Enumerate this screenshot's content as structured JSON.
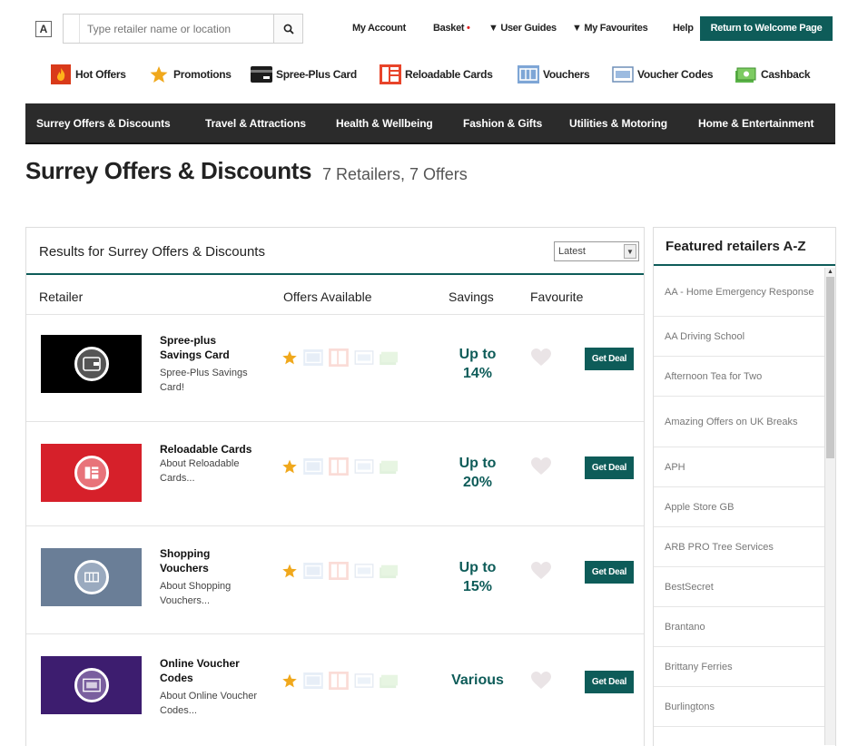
{
  "header": {
    "a11y_label": "A",
    "search_placeholder": "Type retailer name or location",
    "links": {
      "my_account": "My Account",
      "basket": "Basket",
      "basket_marker": "•",
      "user_guides": "▼ User Guides",
      "my_favourites": "▼ My Favourites",
      "help": "Help"
    },
    "welcome_button": "Return to Welcome Page"
  },
  "categories": [
    {
      "label": "Hot Offers",
      "icon": "flame-icon"
    },
    {
      "label": "Promotions",
      "icon": "star-icon"
    },
    {
      "label": "Spree-Plus Card",
      "icon": "card-icon"
    },
    {
      "label": "Reloadable Cards",
      "icon": "reloadable-card-icon"
    },
    {
      "label": "Vouchers",
      "icon": "voucher-icon"
    },
    {
      "label": "Voucher Codes",
      "icon": "voucher-code-icon"
    },
    {
      "label": "Cashback",
      "icon": "cashback-icon"
    }
  ],
  "nav": [
    "Surrey Offers & Discounts",
    "Travel & Attractions",
    "Health & Wellbeing",
    "Fashion & Gifts",
    "Utilities & Motoring",
    "Home & Entertainment"
  ],
  "page": {
    "title": "Surrey Offers & Discounts",
    "count": "7 Retailers, 7 Offers"
  },
  "results": {
    "title": "Results for Surrey Offers & Discounts",
    "sort_selected": "Latest",
    "columns": {
      "retailer": "Retailer",
      "offers": "Offers Available",
      "savings": "Savings",
      "favourite": "Favourite"
    },
    "deal_label": "Get Deal",
    "rows": [
      {
        "name": "Spree-plus Savings Card",
        "desc": "Spree-Plus Savings Card!",
        "saving_line1": "Up to",
        "saving_line2": "14%",
        "thumb_color": "#000000",
        "icon": "wallet-icon"
      },
      {
        "name": "Reloadable Cards",
        "desc": "About Reloadable Cards...",
        "saving_line1": "Up to",
        "saving_line2": "20%",
        "thumb_color": "#d6202a",
        "icon": "reloadable-card-icon"
      },
      {
        "name": "Shopping Vouchers",
        "desc": "About Shopping Vouchers...",
        "saving_line1": "Up to",
        "saving_line2": "15%",
        "thumb_color": "#6a7e97",
        "icon": "voucher-icon"
      },
      {
        "name": "Online Voucher Codes",
        "desc": "About Online Voucher Codes...",
        "saving_line1": "Various",
        "saving_line2": "",
        "thumb_color": "#3d1d6f",
        "icon": "voucher-code-icon"
      }
    ]
  },
  "featured": {
    "title": "Featured retailers A-Z",
    "items": [
      "AA - Home Emergency Response",
      "AA Driving School",
      "Afternoon Tea for Two",
      "Amazing Offers on UK Breaks",
      "APH",
      "Apple Store GB",
      "ARB PRO Tree Services",
      "BestSecret",
      "Brantano",
      "Brittany Ferries",
      "Burlingtons"
    ]
  },
  "colors": {
    "brand": "#0e5c59",
    "nav_bg": "#2b2b2b",
    "star": "#f0a81c"
  }
}
